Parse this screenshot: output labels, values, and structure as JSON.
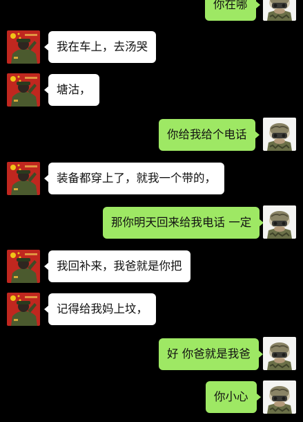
{
  "chat": {
    "messages": [
      {
        "side": "out",
        "text": "你在哪"
      },
      {
        "side": "in",
        "text": "我在车上，去汤哭"
      },
      {
        "side": "in",
        "text": "塘沽，"
      },
      {
        "side": "out",
        "text": "你给我给个电话"
      },
      {
        "side": "in",
        "text": "装备都穿上了，就我一个带的，"
      },
      {
        "side": "out",
        "text": "那你明天回来给我电话 一定"
      },
      {
        "side": "in",
        "text": "我回补来，我爸就是你把"
      },
      {
        "side": "in",
        "text": "记得给我妈上坟，"
      },
      {
        "side": "out",
        "text": "好 你爸就是我爸"
      },
      {
        "side": "out",
        "text": "你小心"
      }
    ]
  },
  "avatars": {
    "incoming_icon": "firefighter-salute-avatar-icon",
    "outgoing_icon": "soldier-helmet-avatar-icon"
  },
  "colors": {
    "background": "#000000",
    "incoming_bubble": "#ffffff",
    "outgoing_bubble": "#9ee864",
    "text": "#111111"
  }
}
